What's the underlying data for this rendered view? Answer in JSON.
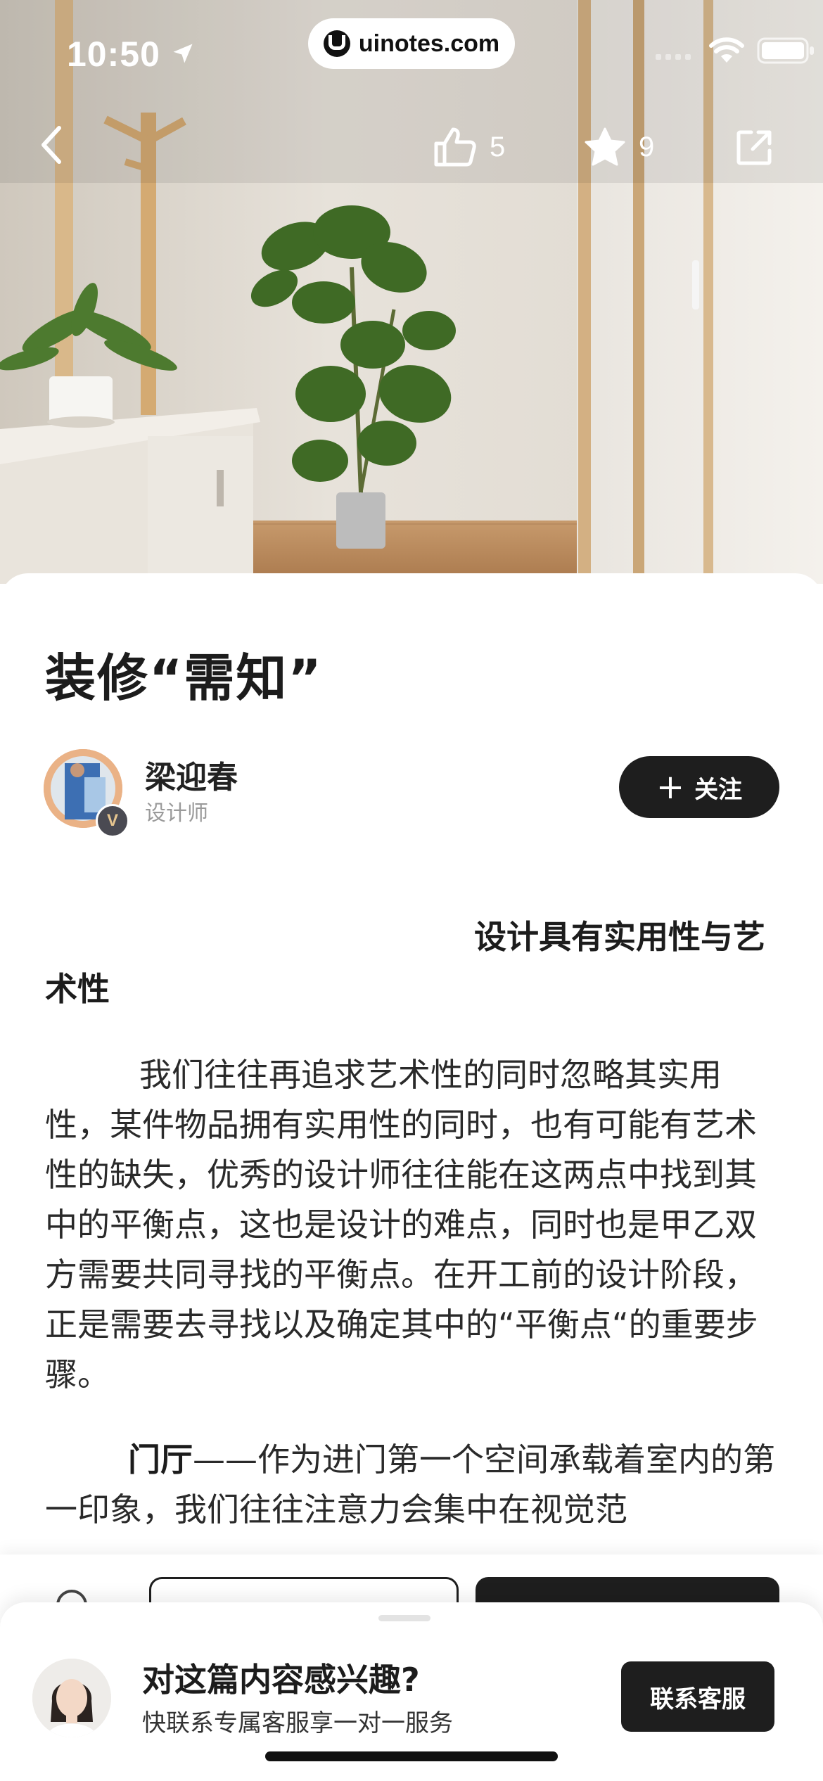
{
  "status_bar": {
    "time": "10:50",
    "url": "uinotes.com",
    "icons": [
      "location-arrow-icon",
      "signal-icon",
      "wifi-icon",
      "battery-icon"
    ]
  },
  "nav": {
    "like_count": "5",
    "favorite_count": "9",
    "icons": [
      "back-chevron-icon",
      "thumbs-up-icon",
      "star-icon",
      "share-icon"
    ]
  },
  "article": {
    "title": "装修“需知”",
    "author": {
      "name": "梁迎春",
      "role": "设计师",
      "badge": "V"
    },
    "follow_label": "关注",
    "subhead": "设计具有实用性与艺术性",
    "paragraph1": "我们往往再追求艺术性的同时忽略其实用性，某件物品拥有实用性的同时，也有可能有艺术性的缺失，优秀的设计师往往能在这两点中找到其中的平衡点，这也是设计的难点，同时也是甲乙双方需要共同寻找的平衡点。在开工前的设计阶段，正是需要去寻找以及确定其中的“平衡点“的重要步骤。",
    "paragraph2_bold": "门厅",
    "paragraph2_rest": "——作为进门第一个空间承载着室内的第一印象，我们往往注意力会集中在视觉范"
  },
  "service_sheet": {
    "title": "对这篇内容感兴趣?",
    "subtitle": "快联系专属客服享一对一服务",
    "button_label": "联系客服"
  },
  "colors": {
    "primary_dark": "#1e1e1e",
    "background": "#ffffff",
    "muted_text": "#9a9a9a"
  }
}
